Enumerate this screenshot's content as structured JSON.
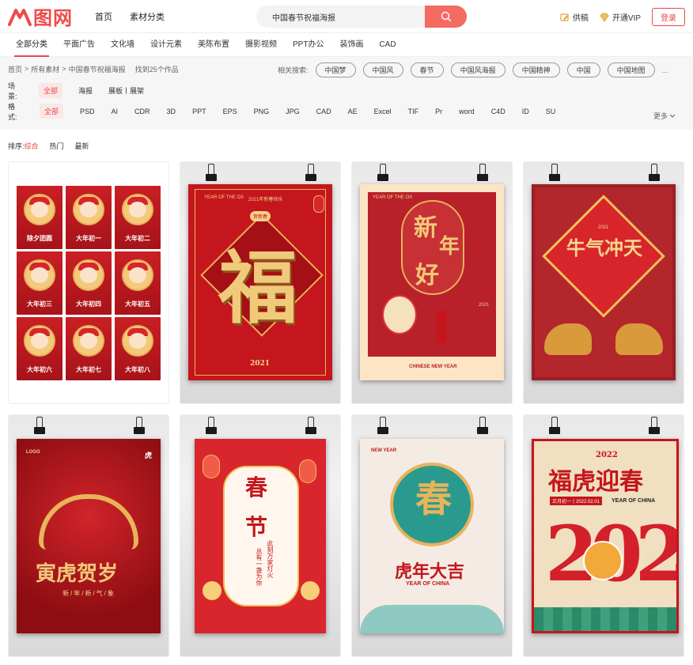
{
  "brand": {
    "logo_text": "图网",
    "accent": "#ef4b4b"
  },
  "top_nav": {
    "home": "首页",
    "material_category": "素材分类"
  },
  "search": {
    "value": "中国春节祝福海报",
    "button_icon": "search-icon"
  },
  "actions": {
    "contribute": "供稿",
    "vip": "开通VIP",
    "login": "登录"
  },
  "category_tabs": [
    "全部分类",
    "平面广告",
    "文化墙",
    "设计元素",
    "美陈布置",
    "摄影视频",
    "PPT办公",
    "装饰画",
    "CAD"
  ],
  "breadcrumb": {
    "home": "首页",
    "all": "所有素材",
    "current": "中国春节祝福海报",
    "sep": ">",
    "result": "找到25个作品"
  },
  "related": {
    "label": "相关搜索:",
    "terms": [
      "中国梦",
      "中国风",
      "春节",
      "中国风海报",
      "中国精神",
      "中国",
      "中国地图"
    ],
    "more": "..."
  },
  "scene": {
    "label": "场景:",
    "options": [
      "全部",
      "海报",
      "展板丨展架"
    ]
  },
  "format": {
    "label": "格式:",
    "options": [
      "全部",
      "PSD",
      "AI",
      "CDR",
      "3D",
      "PPT",
      "EPS",
      "PNG",
      "JPG",
      "CAD",
      "AE",
      "Excel",
      "TIF",
      "Pr",
      "word",
      "C4D",
      "ID",
      "SU"
    ],
    "more": "更多"
  },
  "sort": {
    "label": "排序:",
    "options": [
      "综合",
      "热门",
      "最新"
    ]
  },
  "cards": [
    {
      "type": "grid",
      "minis": [
        "除夕团圆",
        "大年初一",
        "大年初二",
        "大年初三",
        "大年初四",
        "大年初五",
        "大年初六",
        "大年初七",
        "大年初八"
      ]
    },
    {
      "type": "poster",
      "main": "福",
      "top": "YEAR OF THE OX",
      "sub": "2021年新春快乐",
      "year": "2021",
      "badge": "贺新春"
    },
    {
      "type": "poster",
      "main_chars": [
        "新",
        "年",
        "好"
      ],
      "top": "YEAR OF THE OX",
      "bottom": "CHINESE NEW YEAR",
      "year": "2021"
    },
    {
      "type": "poster",
      "main": "牛气冲天",
      "year": "2021"
    },
    {
      "type": "poster",
      "main": "寅虎贺岁",
      "sub": "新/年/新/气/象",
      "top": "LOGO",
      "badge": "虎"
    },
    {
      "type": "poster",
      "main_chars": [
        "春",
        "节"
      ],
      "sub_lines": [
        "此刻万家灯火",
        "总有一盏为你"
      ]
    },
    {
      "type": "poster",
      "main": "虎年大吉",
      "sub": "YEAR OF CHINA",
      "top": "NEW YEAR",
      "badge": "春"
    },
    {
      "type": "poster",
      "main": "福虎迎春",
      "sub": "YEAR OF CHINA",
      "year": "2022",
      "date": "正月初一丨2022.02.01"
    }
  ]
}
